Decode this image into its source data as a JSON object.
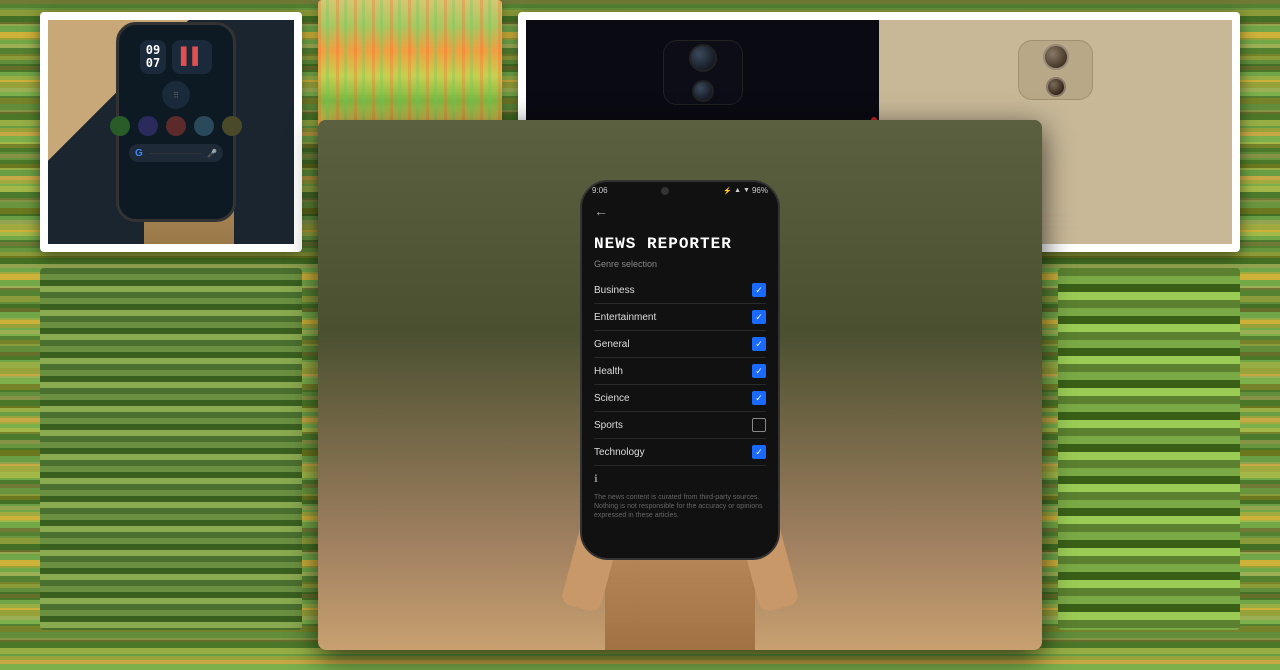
{
  "background": {
    "color": "#5a7a3a"
  },
  "photos": [
    {
      "id": "top-left",
      "description": "Hand holding Pixel phone with dark screen",
      "alt": "Pixel phone front"
    },
    {
      "id": "top-mid",
      "description": "Colorful sand/gravel close-up",
      "alt": "Colorful sand texture"
    },
    {
      "id": "top-right",
      "description": "Two phones back panels",
      "alt": "Phone backs"
    },
    {
      "id": "bottom-center",
      "description": "Hand holding phone with News Reporter app",
      "alt": "News Reporter app"
    }
  ],
  "pixel_phone": {
    "time": "09\n07",
    "app_icons": [
      "phone",
      "music",
      "maps",
      "wifi",
      "settings"
    ],
    "google_bar": "G"
  },
  "news_reporter_app": {
    "status_bar": {
      "time": "9:06",
      "battery": "96%",
      "signal_icons": "⚡▲▼"
    },
    "title": "NEWS REPORTER",
    "subtitle": "Genre selection",
    "genres": [
      {
        "name": "Business",
        "checked": true
      },
      {
        "name": "Entertainment",
        "checked": true
      },
      {
        "name": "General",
        "checked": true
      },
      {
        "name": "Health",
        "checked": true
      },
      {
        "name": "Science",
        "checked": true
      },
      {
        "name": "Sports",
        "checked": false
      },
      {
        "name": "Technology",
        "checked": true
      }
    ],
    "disclaimer": "The news content is curated from third-party sources.\nNothing is not responsible for the accuracy or opinions\nexpressed in these articles.",
    "back_arrow": "←"
  },
  "colors": {
    "checked_blue": "#1a6aff",
    "phone_bg": "#111111",
    "screen_text": "#dddddd",
    "label_text": "#888888"
  }
}
